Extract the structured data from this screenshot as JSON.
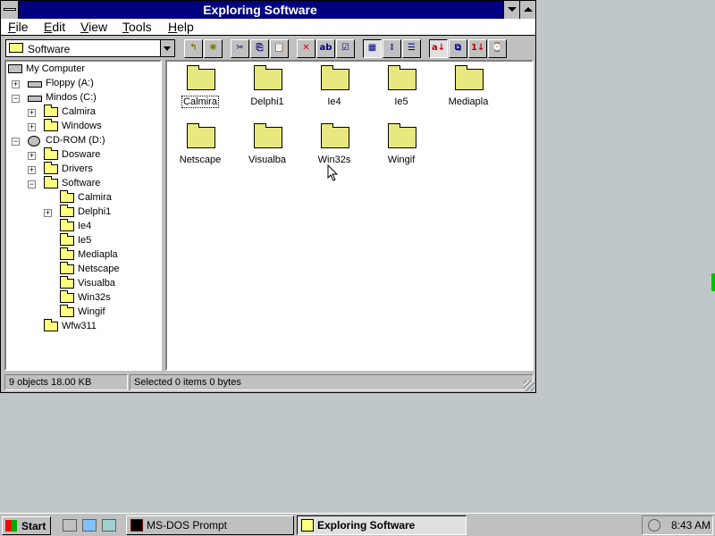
{
  "window": {
    "title": "Exploring Software"
  },
  "menu": [
    "File",
    "Edit",
    "View",
    "Tools",
    "Help"
  ],
  "toolbar": {
    "location": "Software",
    "buttons": [
      {
        "name": "up-one-level-icon",
        "glyph": "↰"
      },
      {
        "name": "new-folder-icon",
        "glyph": "✱"
      },
      {
        "name": "cut-icon",
        "glyph": "✂"
      },
      {
        "name": "copy-icon",
        "glyph": "⎘"
      },
      {
        "name": "paste-icon",
        "glyph": "📋"
      },
      {
        "name": "delete-icon",
        "glyph": "✕"
      },
      {
        "name": "rename-icon",
        "glyph": "ab"
      },
      {
        "name": "properties-icon",
        "glyph": "☑"
      },
      {
        "name": "large-icons-view-icon",
        "glyph": "▦"
      },
      {
        "name": "small-icons-view-icon",
        "glyph": "⁝"
      },
      {
        "name": "details-view-icon",
        "glyph": "☰"
      },
      {
        "name": "sort-by-name-icon",
        "glyph": "a↓"
      },
      {
        "name": "sort-by-type-icon",
        "glyph": "⧉"
      },
      {
        "name": "sort-by-size-icon",
        "glyph": "1↓"
      },
      {
        "name": "sort-by-date-icon",
        "glyph": "⌚"
      }
    ]
  },
  "tree": [
    {
      "label": "My Computer",
      "icon": "computer",
      "level": 0,
      "expander": ""
    },
    {
      "label": "Floppy (A:)",
      "icon": "drive",
      "level": 1,
      "expander": "+"
    },
    {
      "label": "Mindos (C:)",
      "icon": "drive",
      "level": 1,
      "expander": "−"
    },
    {
      "label": "Calmira",
      "icon": "folder",
      "level": 2,
      "expander": "+"
    },
    {
      "label": "Windows",
      "icon": "folder",
      "level": 2,
      "expander": "+"
    },
    {
      "label": "CD-ROM (D:)",
      "icon": "cdrom",
      "level": 1,
      "expander": "−"
    },
    {
      "label": "Dosware",
      "icon": "folder",
      "level": 2,
      "expander": "+"
    },
    {
      "label": "Drivers",
      "icon": "folder",
      "level": 2,
      "expander": "+"
    },
    {
      "label": "Software",
      "icon": "folder",
      "level": 2,
      "expander": "−"
    },
    {
      "label": "Calmira",
      "icon": "folder",
      "level": 3,
      "expander": ""
    },
    {
      "label": "Delphi1",
      "icon": "folder",
      "level": 3,
      "expander": "+"
    },
    {
      "label": "Ie4",
      "icon": "folder",
      "level": 3,
      "expander": ""
    },
    {
      "label": "Ie5",
      "icon": "folder",
      "level": 3,
      "expander": ""
    },
    {
      "label": "Mediapla",
      "icon": "folder",
      "level": 3,
      "expander": ""
    },
    {
      "label": "Netscape",
      "icon": "folder",
      "level": 3,
      "expander": ""
    },
    {
      "label": "Visualba",
      "icon": "folder",
      "level": 3,
      "expander": ""
    },
    {
      "label": "Win32s",
      "icon": "folder",
      "level": 3,
      "expander": ""
    },
    {
      "label": "Wingif",
      "icon": "folder",
      "level": 3,
      "expander": ""
    },
    {
      "label": "Wfw311",
      "icon": "folder",
      "level": 2,
      "expander": ""
    }
  ],
  "files": [
    {
      "label": "Calmira",
      "focused": true
    },
    {
      "label": "Delphi1"
    },
    {
      "label": "Ie4"
    },
    {
      "label": "Ie5"
    },
    {
      "label": "Mediapla"
    },
    {
      "label": "Netscape"
    },
    {
      "label": "Visualba"
    },
    {
      "label": "Win32s"
    },
    {
      "label": "Wingif"
    }
  ],
  "status": {
    "objects": "9 objects  18.00 KB",
    "selected": "Selected 0 items  0 bytes"
  },
  "taskbar": {
    "start_label": "Start",
    "tasks": [
      {
        "label": "MS-DOS Prompt",
        "active": false
      },
      {
        "label": "Exploring Software",
        "active": true
      }
    ],
    "clock": "8:43 AM"
  }
}
